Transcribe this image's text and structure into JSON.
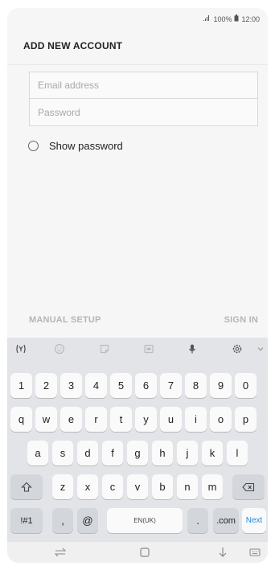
{
  "status_bar": {
    "signal_text": "…",
    "battery_text": "100%",
    "time": "12:00"
  },
  "header": {
    "title": "ADD NEW ACCOUNT"
  },
  "form": {
    "email": {
      "placeholder": "Email address",
      "value": ""
    },
    "password": {
      "placeholder": "Password",
      "value": ""
    },
    "show_password_label": "Show password"
  },
  "actions": {
    "manual_setup_label": "MANUAL SETUP",
    "sign_in_label": "SIGN IN"
  },
  "keyboard": {
    "toolbar": [
      "bixby-icon",
      "emoji-icon",
      "sticker-icon",
      "gif-icon",
      "mic-icon",
      "settings-icon",
      "chevron-down-icon"
    ],
    "rows": {
      "numbers": [
        "1",
        "2",
        "3",
        "4",
        "5",
        "6",
        "7",
        "8",
        "9",
        "0"
      ],
      "row1": [
        "q",
        "w",
        "e",
        "r",
        "t",
        "y",
        "u",
        "i",
        "o",
        "p"
      ],
      "row2": [
        "a",
        "s",
        "d",
        "f",
        "g",
        "h",
        "j",
        "k",
        "l"
      ],
      "row3": [
        "z",
        "x",
        "c",
        "v",
        "b",
        "n",
        "m"
      ],
      "bottom": {
        "symbols": "!#1",
        "comma": ",",
        "at": "@",
        "space": "EN(UK)",
        "period": ".",
        "dotcom": ".com",
        "next": "Next"
      }
    }
  },
  "nav_bar": [
    "recent-apps-icon",
    "home-icon",
    "back-icon",
    "keyboard-switch-icon"
  ]
}
